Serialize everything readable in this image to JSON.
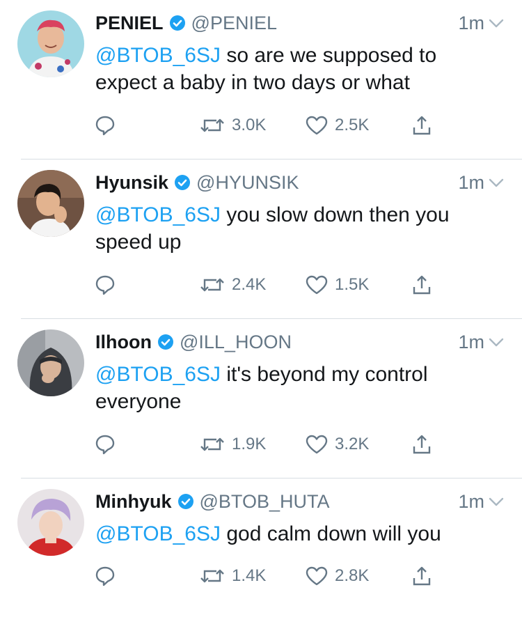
{
  "tweets": [
    {
      "name": "PENIEL",
      "handle": "@PENIEL",
      "time": "1m",
      "mention": "@BTOB_6SJ",
      "text": " so are we supposed to expect a baby in two days or what",
      "retweets": "3.0K",
      "likes": "2.5K"
    },
    {
      "name": "Hyunsik",
      "handle": "@HYUNSIK",
      "time": "1m",
      "mention": "@BTOB_6SJ",
      "text": " you slow down then you speed up",
      "retweets": "2.4K",
      "likes": "1.5K"
    },
    {
      "name": "Ilhoon",
      "handle": "@ILL_HOON",
      "time": "1m",
      "mention": "@BTOB_6SJ",
      "text": " it's beyond my control everyone",
      "retweets": "1.9K",
      "likes": "3.2K"
    },
    {
      "name": "Minhyuk",
      "handle": "@BTOB_HUTA",
      "time": "1m",
      "mention": "@BTOB_6SJ",
      "text": " god calm down will you",
      "retweets": "1.4K",
      "likes": "2.8K"
    }
  ],
  "colors": {
    "accent": "#1da1f2",
    "secondary_text": "#657786",
    "primary_text": "#14171a",
    "divider": "#d8dde2"
  },
  "icons": {
    "verified": "verified-badge-icon",
    "menu": "chevron-down-icon",
    "reply": "reply-icon",
    "retweet": "retweet-icon",
    "like": "heart-icon",
    "share": "share-icon"
  }
}
